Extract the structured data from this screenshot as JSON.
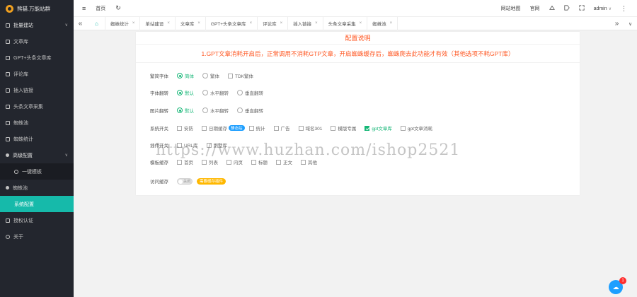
{
  "app": {
    "title": "熊猫.万能站群"
  },
  "sidebar": {
    "items": [
      {
        "label": "批量建站",
        "arrow": "∨"
      },
      {
        "label": "文章库"
      },
      {
        "label": "GPT+头条文章库"
      },
      {
        "label": "评论库"
      },
      {
        "label": "插入链接"
      },
      {
        "label": "头条文章采集"
      },
      {
        "label": "蜘蛛池"
      },
      {
        "label": "蜘蛛统计"
      },
      {
        "label": "高级配置",
        "arrow": "∨"
      },
      {
        "label": "一键模板"
      },
      {
        "label": "蜘蛛池"
      },
      {
        "label": "系统配置"
      },
      {
        "label": "授权认证"
      },
      {
        "label": "关于"
      }
    ]
  },
  "topbar": {
    "menu_icon": "≡",
    "home": "首页",
    "refresh_icon": "↻",
    "site_map": "网站地图",
    "website": "官网",
    "user": "admin",
    "user_arrow": "∨",
    "more_icon": "⋮"
  },
  "tabs": {
    "left_icon": "«",
    "right_icon": "»",
    "down_icon": "∨",
    "home_icon": "⌂",
    "close": "×",
    "items": [
      "蜘蛛统计",
      "单站建设",
      "文章库",
      "GPT+头条文章库",
      "评论库",
      "插入链接",
      "头条文章采集",
      "蜘蛛池"
    ]
  },
  "config": {
    "title": "配置说明",
    "notice": "1.GPT文章消耗开启后，正常调用不消耗GTP文章，开启蜘蛛缓存后，蜘蛛爬去此功能才有效（其他选项不耗GPT库）",
    "rows": {
      "font": {
        "label": "繁简字体",
        "options": [
          "简体",
          "繁体",
          "TDK繁体"
        ]
      },
      "char": {
        "label": "字体翻转",
        "options": [
          "默认",
          "水平翻转",
          "垂直翻转"
        ]
      },
      "img": {
        "label": "图片翻转",
        "options": [
          "默认",
          "水平翻转",
          "垂直翻转"
        ]
      },
      "sys": {
        "label": "系统开关",
        "options": [
          "安防",
          "日期缓存",
          "统计",
          "广告",
          "域名301",
          "模版专属",
          "gpt文章库",
          "gpt文章消耗"
        ],
        "tag": "静态站"
      },
      "ext": {
        "label": "插件开关",
        "options": [
          "URL库",
          "别墅库"
        ]
      },
      "cache": {
        "label": "模板缓存",
        "options": [
          "首页",
          "列表",
          "内页",
          "标题",
          "正文",
          "其他"
        ]
      },
      "visit": {
        "label": "访问缓存",
        "switch_text": "关闭",
        "note": "需要缓存插件"
      }
    }
  },
  "watermark": "https://www.huzhan.com/ishop2521",
  "fab": {
    "icon": "☁",
    "badge": "1"
  },
  "colors": {
    "accent": "#16baaa",
    "orange": "#ff5722",
    "green": "#16b777",
    "blue": "#1e9fff",
    "sidebar": "#23262e"
  }
}
